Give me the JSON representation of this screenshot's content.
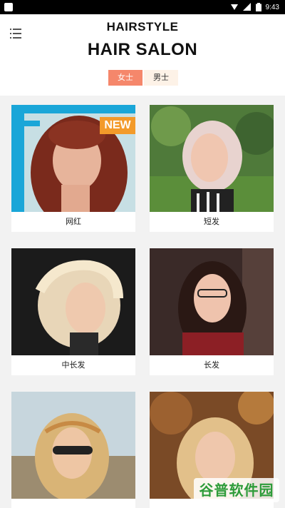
{
  "status_bar": {
    "time": "9:43",
    "icons": [
      "wifi-icon",
      "signal-icon",
      "battery-icon"
    ]
  },
  "header": {
    "subtitle": "HAIRSTYLE",
    "title": "HAIR SALON",
    "menu_icon": "menu-icon",
    "tabs": [
      {
        "label": "女士",
        "active": true
      },
      {
        "label": "男士",
        "active": false
      }
    ]
  },
  "cards": [
    {
      "label": "网红",
      "badge": "NEW"
    },
    {
      "label": "短发"
    },
    {
      "label": "中长发"
    },
    {
      "label": "长发"
    },
    {
      "label": "",
      "partial": true
    },
    {
      "label": "",
      "partial": true
    }
  ],
  "watermark": {
    "text": "谷普软件园"
  },
  "colors": {
    "accent": "#f5876b",
    "tab_inactive_bg": "#fdf2e7",
    "badge": "#f39a2a",
    "grid_bg": "#f2f2f2"
  }
}
